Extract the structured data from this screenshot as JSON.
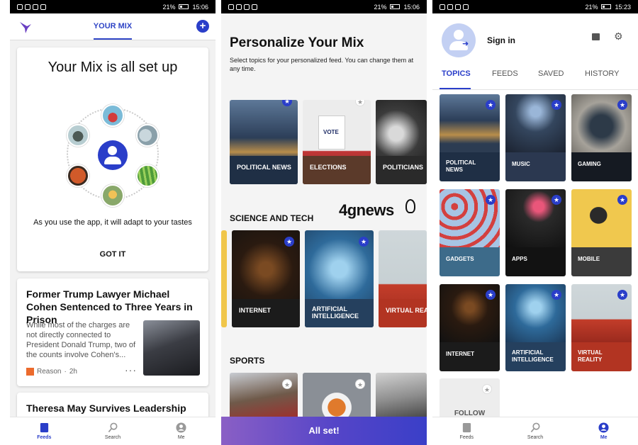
{
  "screen1": {
    "status": {
      "battery": "21%",
      "time": "15:06"
    },
    "header": {
      "tab_label": "YOUR MIX",
      "add_label": "+"
    },
    "mix_card": {
      "title": "Your Mix is all set up",
      "subtitle": "As you use the app, it will adapt to your tastes",
      "got_it": "GOT IT"
    },
    "news": [
      {
        "title": "Former Trump Lawyer Michael Cohen Sentenced to Three Years in Prison",
        "body": "While most of the charges are not directly connected to President Donald Trump, two of the counts involve Cohen's...",
        "source": "Reason",
        "age": "2h",
        "more": "···"
      },
      {
        "title": "Theresa May Survives Leadership Challenge..."
      }
    ],
    "nav": [
      {
        "label": "Feeds",
        "icon": "feeds-icon",
        "active": true
      },
      {
        "label": "Search",
        "icon": "search-icon",
        "active": false
      },
      {
        "label": "Me",
        "icon": "profile-icon",
        "active": false
      }
    ]
  },
  "screen2": {
    "status": {
      "battery": "21%",
      "time": "15:06"
    },
    "title": "Personalize Your Mix",
    "subtitle": "Select topics for your personalized feed. You can change them at any time.",
    "top_row": [
      {
        "label": "POLITICAL NEWS"
      },
      {
        "label": "ELECTIONS",
        "sign": "VOTE"
      },
      {
        "label": "POLITICIANS"
      }
    ],
    "science_label": "SCIENCE AND TECH",
    "brand": "4gnews",
    "science_row": [
      {
        "label": "INTERNET"
      },
      {
        "label": "ARTIFICIAL INTELLIGENCE"
      },
      {
        "label": "VIRTUAL REAL"
      }
    ],
    "sports_label": "SPORTS",
    "all_set": "All set!"
  },
  "screen3": {
    "status": {
      "battery": "21%",
      "time": "15:23"
    },
    "sign_in": "Sign in",
    "tabs": [
      "TOPICS",
      "FEEDS",
      "SAVED",
      "HISTORY"
    ],
    "topics": [
      {
        "label": "POLITICAL NEWS"
      },
      {
        "label": "MUSIC"
      },
      {
        "label": "GAMING"
      },
      {
        "label": "GADGETS"
      },
      {
        "label": "APPS"
      },
      {
        "label": "MOBILE"
      },
      {
        "label": "INTERNET"
      },
      {
        "label": "ARTIFICIAL INTELLIGENCE"
      },
      {
        "label": "VIRTUAL REALITY"
      }
    ],
    "follow": "FOLLOW",
    "nav": [
      {
        "label": "Feeds",
        "icon": "feeds-icon",
        "active": false
      },
      {
        "label": "Search",
        "icon": "search-icon",
        "active": false
      },
      {
        "label": "Me",
        "icon": "profile-icon",
        "active": true
      }
    ]
  },
  "colors": {
    "accent": "#2a3ec9",
    "all_set_from": "#8a5fc5",
    "all_set_to": "#3a3fc8"
  }
}
